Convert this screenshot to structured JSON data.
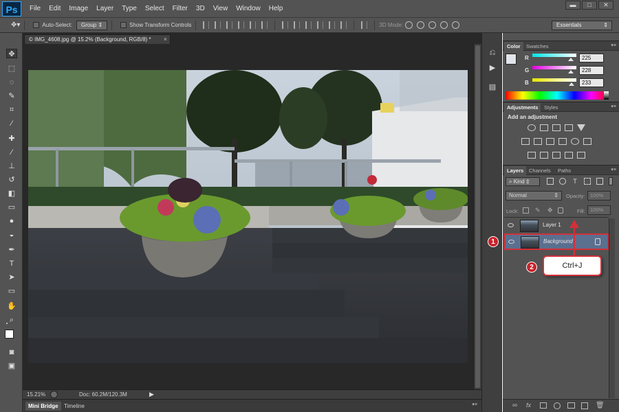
{
  "app": {
    "logo": "Ps"
  },
  "menu": [
    "File",
    "Edit",
    "Image",
    "Layer",
    "Type",
    "Select",
    "Filter",
    "3D",
    "View",
    "Window",
    "Help"
  ],
  "window_controls": {
    "minimize": "▬",
    "maximize": "□",
    "close": "✕"
  },
  "options_bar": {
    "auto_select_label": "Auto-Select:",
    "auto_select_value": "Group",
    "show_transform_label": "Show Transform Controls",
    "mode_3d_label": "3D Mode:",
    "workspace": "Essentials"
  },
  "document": {
    "tab_title": "© IMG_4608.jpg @ 15.2% (Background, RGB/8) *",
    "tab_close": "×",
    "zoom": "15.21%",
    "doc_size": "Doc: 60.2M/120.3M"
  },
  "bottom_tabs": [
    "Mini Bridge",
    "Timeline"
  ],
  "color_panel": {
    "tabs": [
      "Color",
      "Swatches"
    ],
    "channels": [
      {
        "label": "R",
        "value": "225"
      },
      {
        "label": "G",
        "value": "228"
      },
      {
        "label": "B",
        "value": "233"
      }
    ],
    "track_colors": [
      "#00e5e5",
      "#e500e5",
      "#e5e500"
    ]
  },
  "adjustments_panel": {
    "tabs": [
      "Adjustments",
      "Styles"
    ],
    "heading": "Add an adjustment"
  },
  "layers_panel": {
    "tabs": [
      "Layers",
      "Channels",
      "Paths"
    ],
    "filter_kind": "Kind",
    "blend_mode": "Normal",
    "opacity_label": "Opacity:",
    "opacity_value": "100%",
    "lock_label": "Lock:",
    "fill_label": "Fill:",
    "fill_value": "100%",
    "layers": [
      {
        "name": "Layer 1"
      },
      {
        "name": "Background"
      }
    ]
  },
  "annotations": {
    "step1": "1",
    "step2": "2",
    "shortcut": "Ctrl+J",
    "accent": "#d2303a"
  }
}
